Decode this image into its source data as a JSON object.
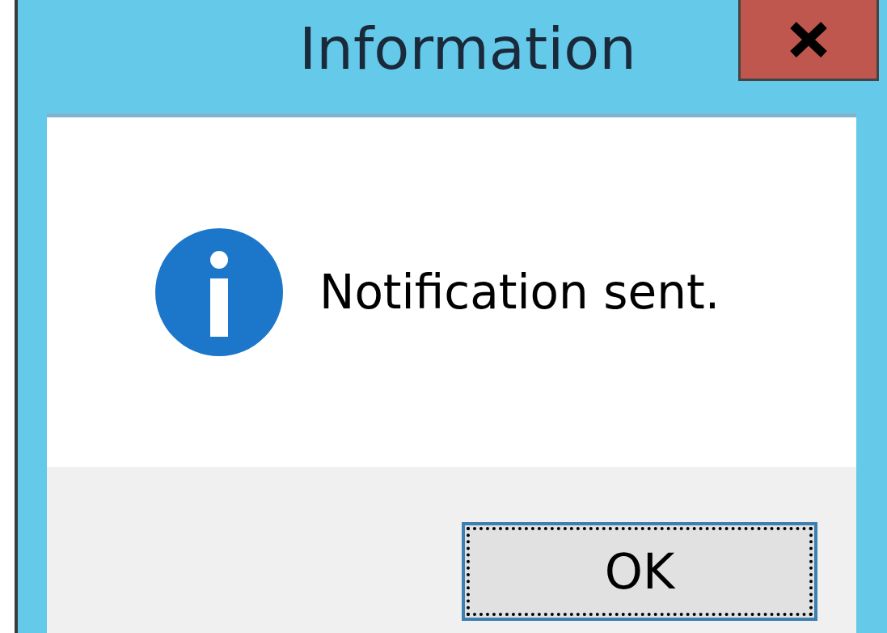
{
  "window": {
    "title": "Information"
  },
  "message": {
    "kind": "info",
    "text": "Notification sent."
  },
  "buttons": [
    {
      "label": "OK",
      "focused": true
    }
  ]
}
